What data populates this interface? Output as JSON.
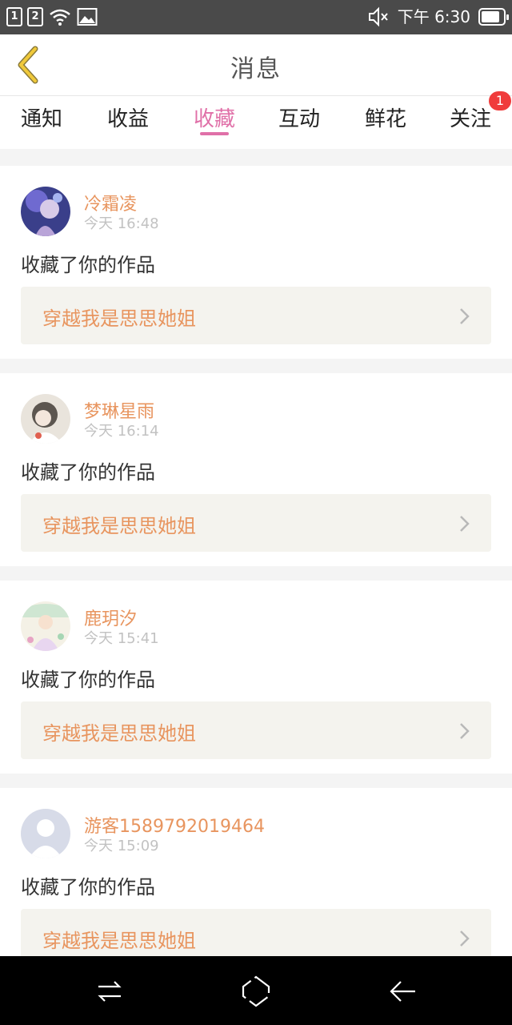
{
  "status_bar": {
    "sim1": "1",
    "sim2": "2",
    "time": "下午 6:30",
    "battery_level": 0.85,
    "icons": [
      "sim1-icon",
      "sim2-icon",
      "wifi-icon",
      "image-icon",
      "mute-icon",
      "battery-icon"
    ]
  },
  "header": {
    "title": "消息",
    "back_icon": "chevron-left-icon"
  },
  "tabs": {
    "items": [
      {
        "label": "通知"
      },
      {
        "label": "收益"
      },
      {
        "label": "收藏"
      },
      {
        "label": "互动"
      },
      {
        "label": "鲜花"
      },
      {
        "label": "关注"
      }
    ],
    "active_index": 2,
    "badge": "1",
    "active_color": "#e070a8"
  },
  "messages": [
    {
      "name": "冷霜凌",
      "time": "今天 16:48",
      "action": "收藏了你的作品",
      "work": "穿越我是思思她姐",
      "avatar_icon": "avatar-icon"
    },
    {
      "name": "梦琳星雨",
      "time": "今天 16:14",
      "action": "收藏了你的作品",
      "work": "穿越我是思思她姐",
      "avatar_icon": "avatar-icon"
    },
    {
      "name": "鹿玥汐",
      "time": "今天 15:41",
      "action": "收藏了你的作品",
      "work": "穿越我是思思她姐",
      "avatar_icon": "avatar-icon"
    },
    {
      "name": "游客1589792019464",
      "time": "今天 15:09",
      "action": "收藏了你的作品",
      "work": "穿越我是思思她姐",
      "avatar_icon": "default-avatar-icon"
    }
  ],
  "nav_bar": {
    "icons": [
      "recent-apps-icon",
      "home-icon",
      "back-icon"
    ]
  },
  "colors": {
    "name": "#e8955f",
    "badge": "#f03c3c",
    "status_bar": "#4a4a4a"
  }
}
